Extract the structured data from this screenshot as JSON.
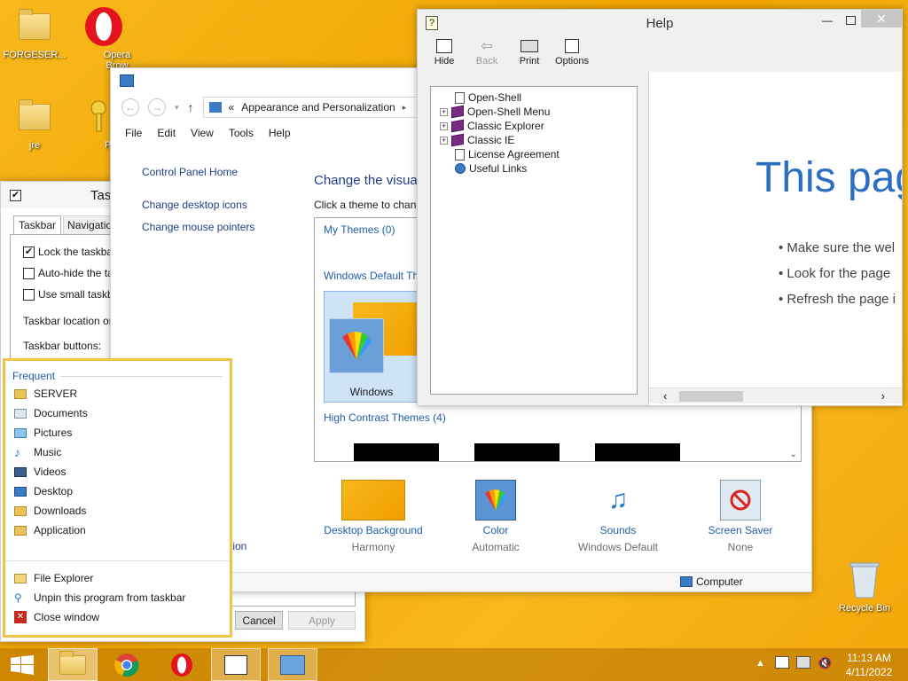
{
  "desktop": {
    "icons": [
      {
        "label": "FORGESER...",
        "type": "folder"
      },
      {
        "label": "Opera Brow",
        "type": "opera"
      },
      {
        "label": "jre",
        "type": "folder"
      },
      {
        "label": "Porte",
        "type": "keys"
      }
    ],
    "recycle_bin": "Recycle Bin"
  },
  "taskbar_props": {
    "title": "Task",
    "tabs": [
      "Taskbar",
      "Navigation"
    ],
    "options": [
      {
        "label": "Lock the taskbar",
        "checked": true
      },
      {
        "label": "Auto-hide the ta",
        "checked": false
      },
      {
        "label": "Use small taskba",
        "checked": false
      }
    ],
    "location_label": "Taskbar location on",
    "buttons_label": "Taskbar buttons:",
    "cancel": "Cancel",
    "apply": "Apply"
  },
  "control_panel": {
    "breadcrumb_prefix": "«",
    "breadcrumb": "Appearance and Personalization",
    "menu": [
      "File",
      "Edit",
      "View",
      "Tools",
      "Help"
    ],
    "left_links": [
      "Control Panel Home",
      "Change desktop icons",
      "Change mouse pointers"
    ],
    "left_bottom_fragment": "tion",
    "main_title": "Change the visua",
    "subtitle": "Click a theme to chan",
    "my_themes": "My Themes (0)",
    "default_themes": "Windows Default Th",
    "theme_windows": "Windows",
    "high_contrast": "High Contrast Themes (4)",
    "bottom": [
      {
        "label": "Desktop Background",
        "sub": "Harmony",
        "icon": "desktop-background-icon"
      },
      {
        "label": "Color",
        "sub": "Automatic",
        "icon": "color-icon"
      },
      {
        "label": "Sounds",
        "sub": "Windows Default",
        "icon": "sounds-icon"
      },
      {
        "label": "Screen Saver",
        "sub": "None",
        "icon": "screen-saver-icon"
      }
    ],
    "status": "Computer"
  },
  "help": {
    "title": "Help",
    "toolbar": [
      "Hide",
      "Back",
      "Print",
      "Options"
    ],
    "tree": [
      {
        "label": "Open-Shell",
        "kind": "doc",
        "expandable": false
      },
      {
        "label": "Open-Shell Menu",
        "kind": "book",
        "expandable": true
      },
      {
        "label": "Classic Explorer",
        "kind": "book",
        "expandable": true
      },
      {
        "label": "Classic IE",
        "kind": "book",
        "expandable": true
      },
      {
        "label": "License Agreement",
        "kind": "doc",
        "expandable": false
      },
      {
        "label": "Useful Links",
        "kind": "link",
        "expandable": false
      }
    ],
    "page_title": "This pag",
    "bullets": [
      "Make sure the wel",
      "Look for the page",
      "Refresh the page i"
    ]
  },
  "jumplist": {
    "frequent_header": "Frequent",
    "frequent": [
      {
        "label": "SERVER",
        "icon": "folder-icon"
      },
      {
        "label": "Documents",
        "icon": "documents-icon"
      },
      {
        "label": "Pictures",
        "icon": "pictures-icon"
      },
      {
        "label": "Music",
        "icon": "music-icon"
      },
      {
        "label": "Videos",
        "icon": "videos-icon"
      },
      {
        "label": "Desktop",
        "icon": "desktop-icon"
      },
      {
        "label": "Downloads",
        "icon": "downloads-icon"
      },
      {
        "label": "Application",
        "icon": "folder-icon"
      }
    ],
    "tasks": [
      {
        "label": "File Explorer",
        "icon": "file-explorer-icon"
      },
      {
        "label": "Unpin this program from taskbar",
        "icon": "unpin-icon"
      },
      {
        "label": "Close window",
        "icon": "close-icon"
      }
    ]
  },
  "clock": {
    "time": "11:13 AM",
    "date": "4/11/2022"
  },
  "colors": {
    "accent": "#f0a400",
    "link": "#1e3f84",
    "jumplist_border": "#f3c24a"
  }
}
